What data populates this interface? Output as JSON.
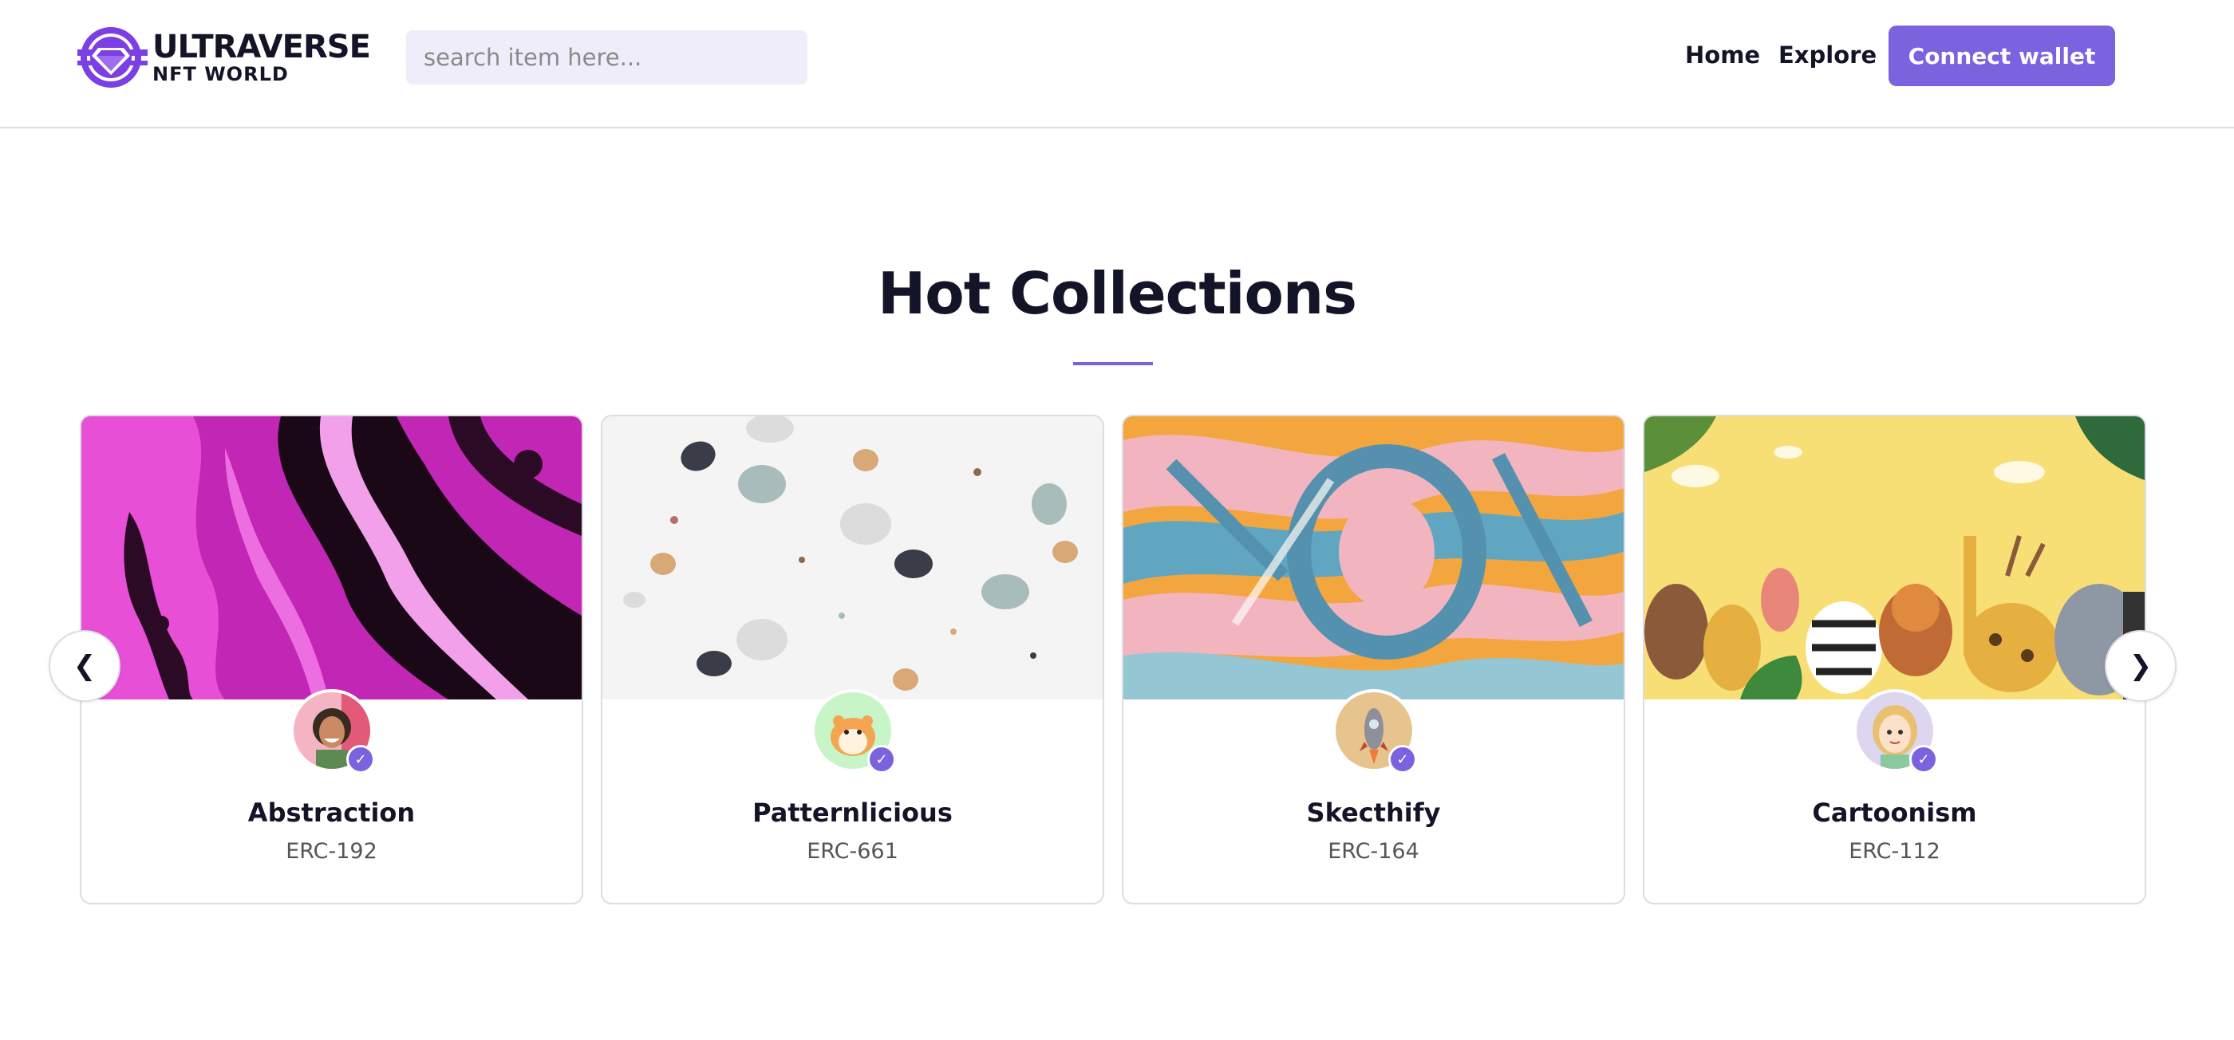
{
  "header": {
    "logo_line1": "ULTRAVERSE",
    "logo_line2": "NFT WORLD",
    "search_placeholder": "search item here...",
    "nav": {
      "home": "Home",
      "explore": "Explore"
    },
    "connect_label": "Connect wallet"
  },
  "colors": {
    "accent": "#7b62df",
    "text": "#141428",
    "search_bg": "#efedf9",
    "border": "#dcdce4"
  },
  "section": {
    "title": "Hot Collections"
  },
  "carousel": {
    "prev_icon": "chevron-left-icon",
    "next_icon": "chevron-right-icon",
    "prev_label": "❮",
    "next_label": "❯",
    "items": [
      {
        "name": "Abstraction",
        "code": "ERC-192",
        "image": "pink-black-fluid-art",
        "avatar": "woman-avatar"
      },
      {
        "name": "Patternlicious",
        "code": "ERC-661",
        "image": "terrazzo-pattern",
        "avatar": "hamster-avatar"
      },
      {
        "name": "Skecthify",
        "code": "ERC-164",
        "image": "brush-stroke-art",
        "avatar": "rocket-avatar"
      },
      {
        "name": "Cartoonism",
        "code": "ERC-112",
        "image": "cartoon-animals",
        "avatar": "cartoon-girl-avatar"
      }
    ]
  }
}
